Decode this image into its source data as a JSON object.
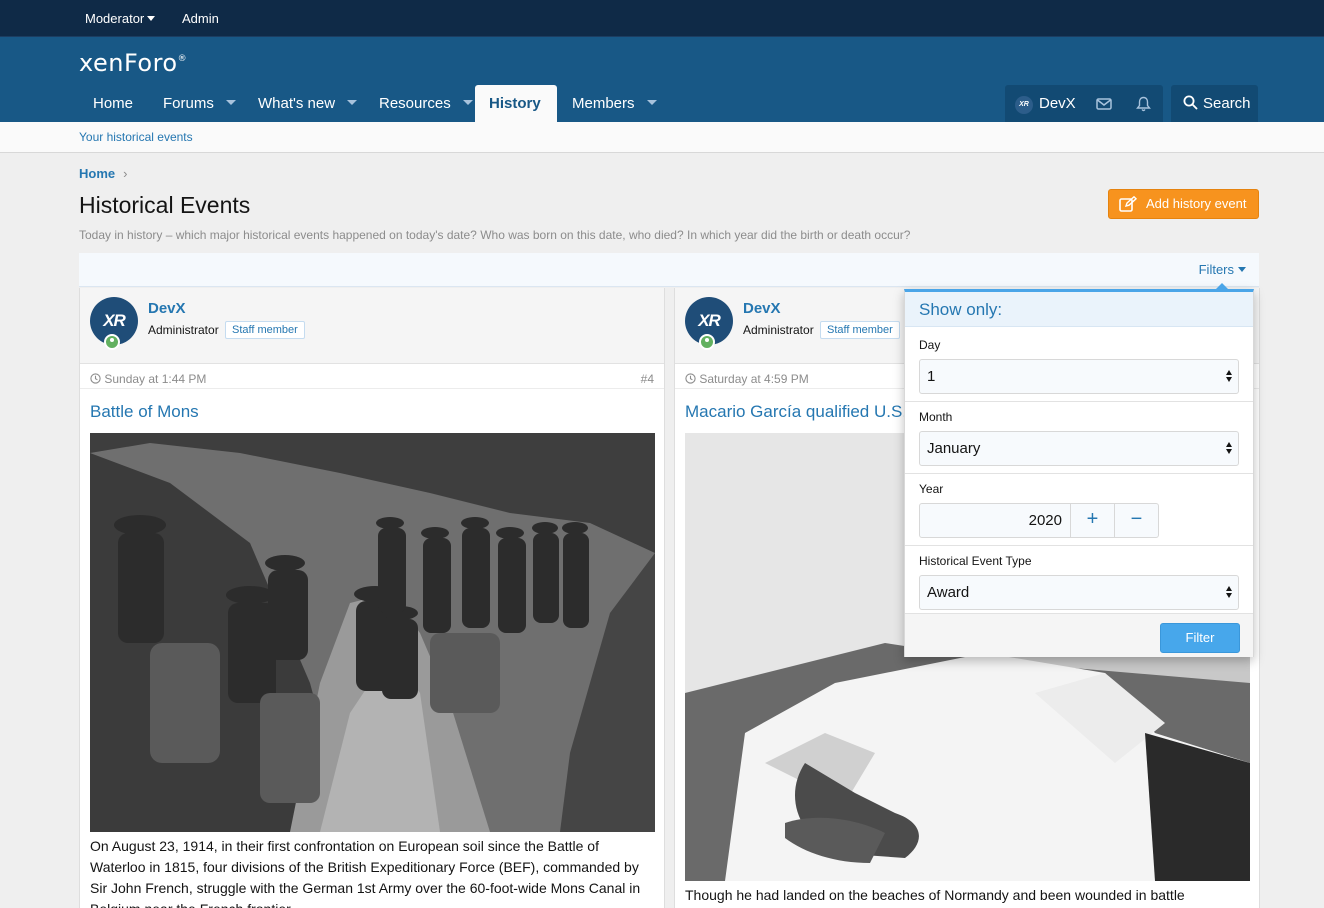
{
  "staff_bar": {
    "moderator_label": "Moderator",
    "admin_label": "Admin"
  },
  "header": {
    "logo_text": "xenForo",
    "logo_mark": "®"
  },
  "nav": {
    "tabs": [
      {
        "label": "Home",
        "has_menu": false,
        "active": false
      },
      {
        "label": "Forums",
        "has_menu": true,
        "active": false
      },
      {
        "label": "What's new",
        "has_menu": true,
        "active": false
      },
      {
        "label": "Resources",
        "has_menu": true,
        "active": false
      },
      {
        "label": "History",
        "has_menu": false,
        "active": true
      },
      {
        "label": "Members",
        "has_menu": true,
        "active": false
      }
    ],
    "user_label": "DevX",
    "search_label": "Search"
  },
  "subnav": {
    "link_label": "Your historical events"
  },
  "breadcrumb": {
    "home_label": "Home"
  },
  "page": {
    "title": "Historical Events",
    "description": "Today in history – which major historical events happened on today's date? Who was born on this date, who died? In which year did the birth or death occur?",
    "add_button_label": "Add history event",
    "filters_label": "Filters"
  },
  "cards": [
    {
      "username": "DevX",
      "user_title": "Administrator",
      "badge": "Staff member",
      "avatar_text": "XR",
      "date": "Sunday at 1:44 PM",
      "number": "#4",
      "title": "Battle of Mons",
      "body": "On August 23, 1914, in their first confrontation on European soil since the Battle of Waterloo in 1815, four divisions of the British Expeditionary Force (BEF), commanded by Sir John French, struggle with the German 1st Army over the 60-foot-wide Mons Canal in Belgium near the French frontier."
    },
    {
      "username": "DevX",
      "user_title": "Administrator",
      "badge": "Staff member",
      "avatar_text": "XR",
      "date": "Saturday at 4:59 PM",
      "number": "",
      "title": "Macario García qualified U.S.",
      "body": "Though he had landed on the beaches of Normandy and been wounded in battle"
    }
  ],
  "filters_menu": {
    "heading": "Show only:",
    "day_label": "Day",
    "day_value": "1",
    "month_label": "Month",
    "month_value": "January",
    "year_label": "Year",
    "year_value": "2020",
    "plus_label": "+",
    "minus_label": "−",
    "type_label": "Historical Event Type",
    "type_value": "Award",
    "submit_label": "Filter"
  },
  "colors": {
    "staff_bar": "#0f2a47",
    "header": "#185886",
    "link": "#2577b1",
    "accent_orange": "#f7931e",
    "filter_button": "#47a7eb"
  }
}
